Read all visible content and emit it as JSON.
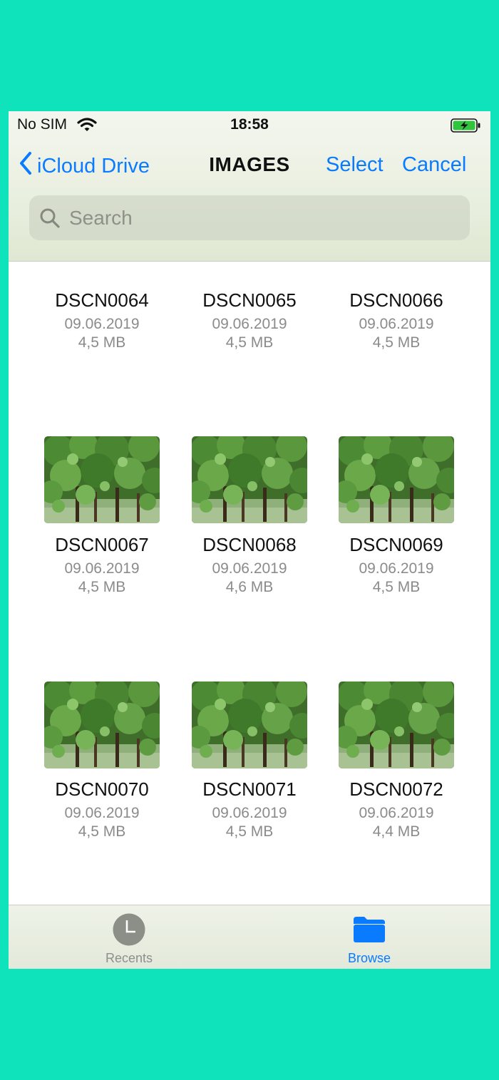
{
  "status": {
    "carrier": "No SIM",
    "time": "18:58"
  },
  "nav": {
    "back_label": "iCloud Drive",
    "title": "IMAGES",
    "select_label": "Select",
    "cancel_label": "Cancel"
  },
  "search": {
    "placeholder": "Search",
    "value": ""
  },
  "files": [
    {
      "name": "DSCN0064",
      "date": "09.06.2019",
      "size": "4,5 MB"
    },
    {
      "name": "DSCN0065",
      "date": "09.06.2019",
      "size": "4,5 MB"
    },
    {
      "name": "DSCN0066",
      "date": "09.06.2019",
      "size": "4,5 MB"
    },
    {
      "name": "DSCN0067",
      "date": "09.06.2019",
      "size": "4,5 MB"
    },
    {
      "name": "DSCN0068",
      "date": "09.06.2019",
      "size": "4,6 MB"
    },
    {
      "name": "DSCN0069",
      "date": "09.06.2019",
      "size": "4,5 MB"
    },
    {
      "name": "DSCN0070",
      "date": "09.06.2019",
      "size": "4,5 MB"
    },
    {
      "name": "DSCN0071",
      "date": "09.06.2019",
      "size": "4,5 MB"
    },
    {
      "name": "DSCN0072",
      "date": "09.06.2019",
      "size": "4,4 MB"
    }
  ],
  "tabs": [
    {
      "label": "Recents",
      "icon": "clock-icon",
      "active": false
    },
    {
      "label": "Browse",
      "icon": "folder-icon",
      "active": true
    }
  ],
  "colors": {
    "accent": "#0a7bff",
    "background": "#0fe3bb",
    "secondary_text": "#8b8b8b"
  }
}
